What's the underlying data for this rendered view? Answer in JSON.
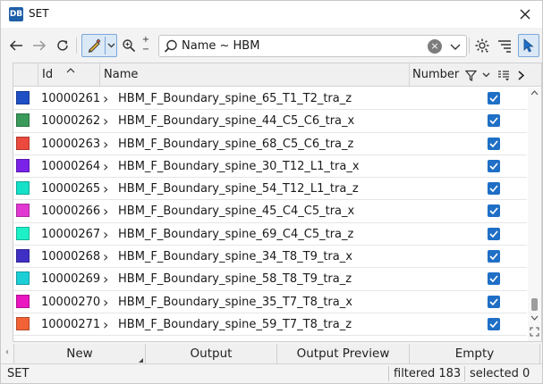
{
  "window": {
    "title": "SET",
    "app_icon_text": "DB"
  },
  "toolbar": {
    "search_value": "Name ~ HBM"
  },
  "table": {
    "columns": {
      "id": "Id",
      "name": "Name",
      "number": "Number"
    },
    "rows": [
      {
        "color": "#1f4fc4",
        "id": "10000261",
        "name": "HBM_F_Boundary_spine_65_T1_T2_tra_z",
        "checked": true
      },
      {
        "color": "#3a9a5a",
        "id": "10000262",
        "name": "HBM_F_Boundary_spine_44_C5_C6_tra_x",
        "checked": true
      },
      {
        "color": "#ec4a3e",
        "id": "10000263",
        "name": "HBM_F_Boundary_spine_68_C5_C6_tra_z",
        "checked": true
      },
      {
        "color": "#7a22e8",
        "id": "10000264",
        "name": "HBM_F_Boundary_spine_30_T12_L1_tra_x",
        "checked": true
      },
      {
        "color": "#15e0c8",
        "id": "10000265",
        "name": "HBM_F_Boundary_spine_54_T12_L1_tra_z",
        "checked": true
      },
      {
        "color": "#e238d2",
        "id": "10000266",
        "name": "HBM_F_Boundary_spine_45_C4_C5_tra_x",
        "checked": true
      },
      {
        "color": "#1ef0c8",
        "id": "10000267",
        "name": "HBM_F_Boundary_spine_69_C4_C5_tra_z",
        "checked": true
      },
      {
        "color": "#3f2fc4",
        "id": "10000268",
        "name": "HBM_F_Boundary_spine_34_T8_T9_tra_x",
        "checked": true
      },
      {
        "color": "#1ccfd6",
        "id": "10000269",
        "name": "HBM_F_Boundary_spine_58_T8_T9_tra_z",
        "checked": true
      },
      {
        "color": "#ea16c0",
        "id": "10000270",
        "name": "HBM_F_Boundary_spine_35_T7_T8_tra_x",
        "checked": true
      },
      {
        "color": "#f26236",
        "id": "10000271",
        "name": "HBM_F_Boundary_spine_59_T7_T8_tra_z",
        "checked": true
      }
    ]
  },
  "bottom_buttons": {
    "new": "New",
    "output": "Output",
    "output_preview": "Output Preview",
    "empty": "Empty"
  },
  "status": {
    "left": "SET",
    "filtered": "filtered 183",
    "selected": "selected 0"
  },
  "colors": {
    "accent": "#1f6fc6",
    "toggle_bg": "#dbe8f6",
    "toggle_border": "#7aa7d8"
  }
}
